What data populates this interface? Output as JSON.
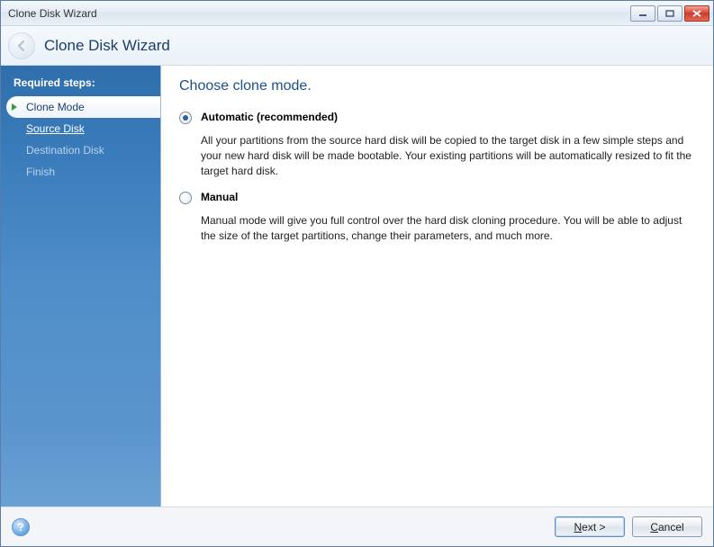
{
  "window": {
    "title": "Clone Disk Wizard"
  },
  "header": {
    "title": "Clone Disk Wizard"
  },
  "sidebar": {
    "header": "Required steps:",
    "steps": [
      {
        "label": "Clone Mode",
        "state": "active"
      },
      {
        "label": "Source Disk",
        "state": "link"
      },
      {
        "label": "Destination Disk",
        "state": "disabled"
      },
      {
        "label": "Finish",
        "state": "disabled"
      }
    ]
  },
  "main": {
    "heading": "Choose clone mode.",
    "options": [
      {
        "id": "automatic",
        "label": "Automatic (recommended)",
        "description": "All your partitions from the source hard disk will be copied to the target disk in a few simple steps and your new hard disk will be made bootable. Your existing partitions will be automatically resized to fit the target hard disk.",
        "checked": true
      },
      {
        "id": "manual",
        "label": "Manual",
        "description": "Manual mode will give you full control over the hard disk cloning procedure. You will be able to adjust the size of the target partitions, change their parameters, and much more.",
        "checked": false
      }
    ]
  },
  "footer": {
    "help": "?",
    "next_prefix": "N",
    "next_suffix": "ext >",
    "cancel_prefix": "C",
    "cancel_suffix": "ancel"
  }
}
